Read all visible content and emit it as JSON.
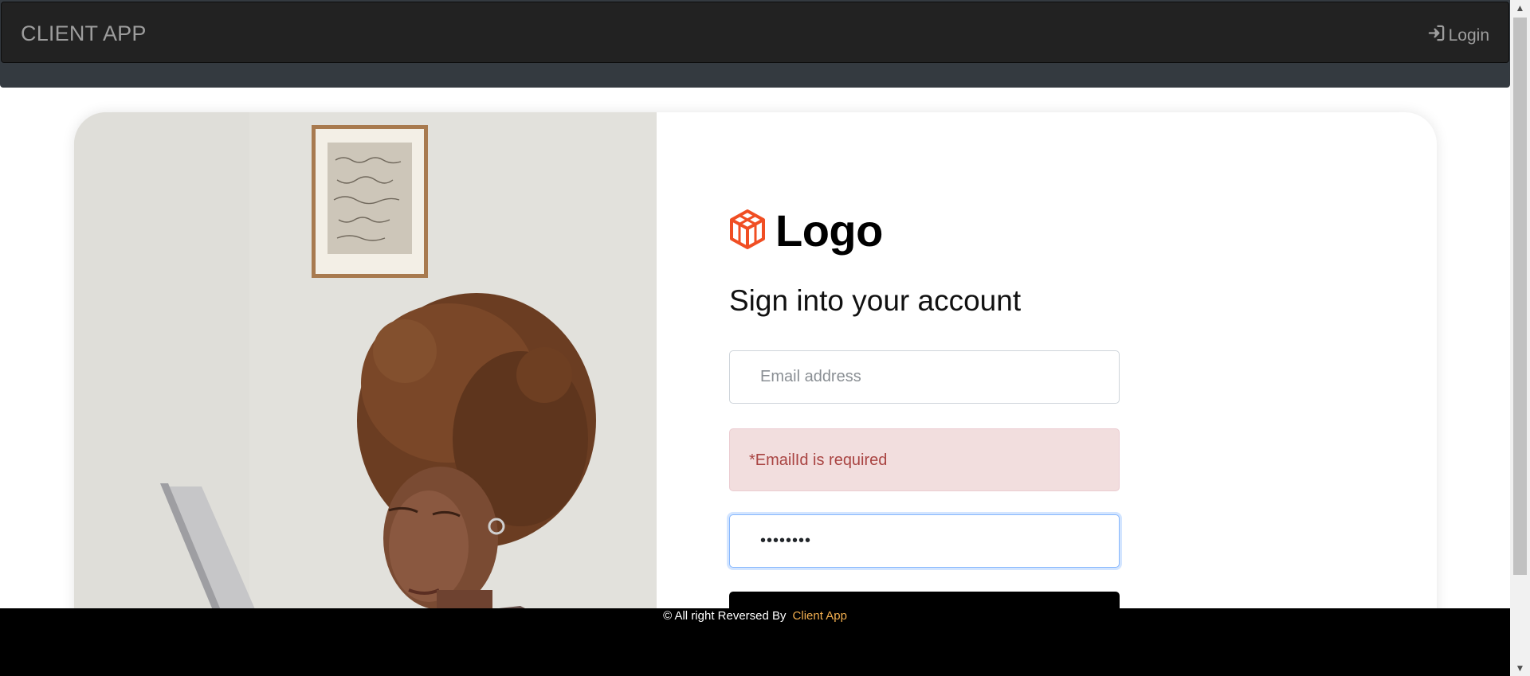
{
  "navbar": {
    "brand": "CLIENT APP",
    "login_label": "Login",
    "login_icon": "sign-in-icon"
  },
  "hero_image": {
    "description_icon": "woman-with-laptop-photo"
  },
  "form": {
    "logo_text": "Logo",
    "logo_icon": "cube-logo-icon",
    "logo_color": "#f04e23",
    "heading": "Sign into your account",
    "email": {
      "placeholder": "Email address",
      "value": ""
    },
    "error_message": "*EmailId is required",
    "password": {
      "value": "••••••••"
    },
    "submit_label": ""
  },
  "footer": {
    "text": "© All right Reversed By",
    "link": "Client App",
    "link_color": "#f0ad4e"
  },
  "colors": {
    "navbar_bg": "#222222",
    "navbar_bottom": "#343a40",
    "alert_bg": "#f2dede",
    "alert_text": "#a94442",
    "footer_bg": "#000000"
  }
}
